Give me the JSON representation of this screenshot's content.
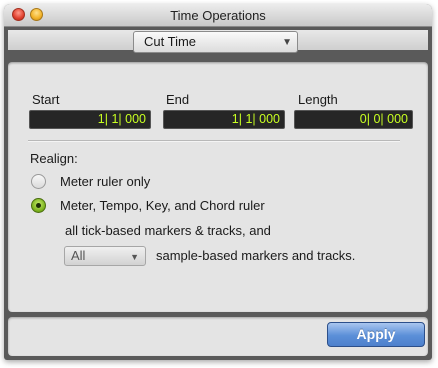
{
  "window": {
    "title": "Time Operations"
  },
  "mode_select": {
    "value": "Cut Time",
    "arrow": "▼"
  },
  "fields": {
    "start": {
      "label": "Start",
      "value": "1| 1| 000"
    },
    "end": {
      "label": "End",
      "value": "1| 1| 000"
    },
    "length": {
      "label": "Length",
      "value": "0| 0| 000"
    }
  },
  "realign": {
    "label": "Realign:",
    "options": [
      {
        "label": "Meter ruler only",
        "selected": false
      },
      {
        "label": "Meter, Tempo, Key, and Chord ruler",
        "selected": true
      }
    ],
    "tick_text": "all tick-based markers & tracks, and",
    "sample_select": {
      "value": "All",
      "arrow": "▼"
    },
    "sample_text": "sample-based markers and tracks."
  },
  "footer": {
    "apply_label": "Apply"
  },
  "colors": {
    "counter_text": "#c8ff22",
    "apply_button": "#5b8fd8",
    "radio_selected": "#7cb21e"
  },
  "icons": [
    "close-icon",
    "minimize-icon",
    "chevron-down-icon"
  ]
}
